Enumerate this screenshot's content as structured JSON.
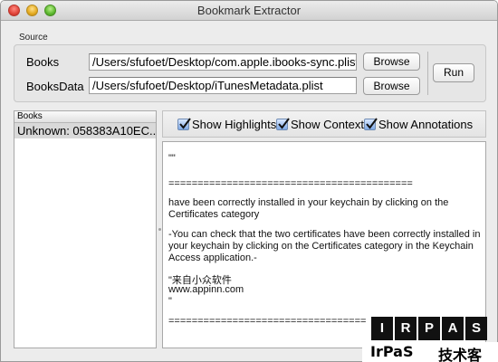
{
  "window": {
    "title": "Bookmark Extractor"
  },
  "source": {
    "group_label": "Source",
    "books_label": "Books",
    "books_path": "/Users/sfufoet/Desktop/com.apple.ibooks-sync.plist",
    "booksdata_label": "BooksData",
    "booksdata_path": "/Users/sfufoet/Desktop/iTunesMetadata.plist",
    "browse_label": "Browse",
    "run_label": "Run"
  },
  "books_list": {
    "header": "Books",
    "items": [
      "Unknown: 058383A10EC..."
    ]
  },
  "options": {
    "show_highlights": "Show Highlights",
    "show_context": "Show Context",
    "show_annotations": "Show Annotations",
    "show_highlights_checked": true,
    "show_context_checked": true,
    "show_annotations_checked": true
  },
  "content": {
    "lines": [
      "\"\"",
      "==========================================",
      "have been correctly installed in your keychain by clicking on the",
      "Certificates category",
      "-You can check that the two certificates have been correctly installed in",
      "your keychain by clicking on the Certificates category in the Keychain",
      "Access application.-",
      "\"来自小众软件",
      "www.appinn.com",
      "\"",
      "=================================="
    ]
  },
  "watermark": {
    "letters": [
      "I",
      "R",
      "P",
      "A",
      "S"
    ],
    "latin": "IrPaS",
    "chinese": "技术客"
  },
  "colors": {
    "window_bg": "#ececec",
    "selection_row": "#d9d9d9",
    "checkbox_blue": "#7fa9e6"
  }
}
